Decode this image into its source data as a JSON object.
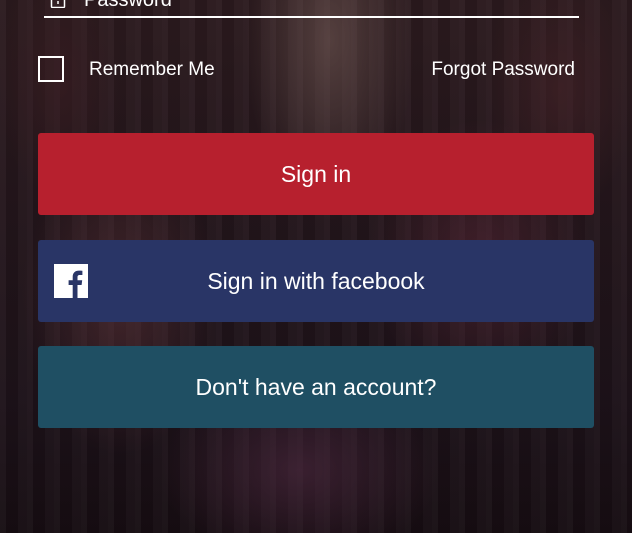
{
  "colors": {
    "sign_in_button": "#b7202e",
    "facebook_button": "#293566",
    "signup_button": "#1f4f63",
    "text": "#ffffff"
  },
  "password": {
    "placeholder": "Password",
    "value": "",
    "icon": "lock-icon"
  },
  "remember": {
    "label": "Remember Me",
    "checked": false
  },
  "forgot_password_label": "Forgot Password",
  "buttons": {
    "sign_in": "Sign in",
    "facebook": "Sign in with facebook",
    "facebook_icon": "facebook-icon",
    "signup": "Don't have an account?"
  }
}
